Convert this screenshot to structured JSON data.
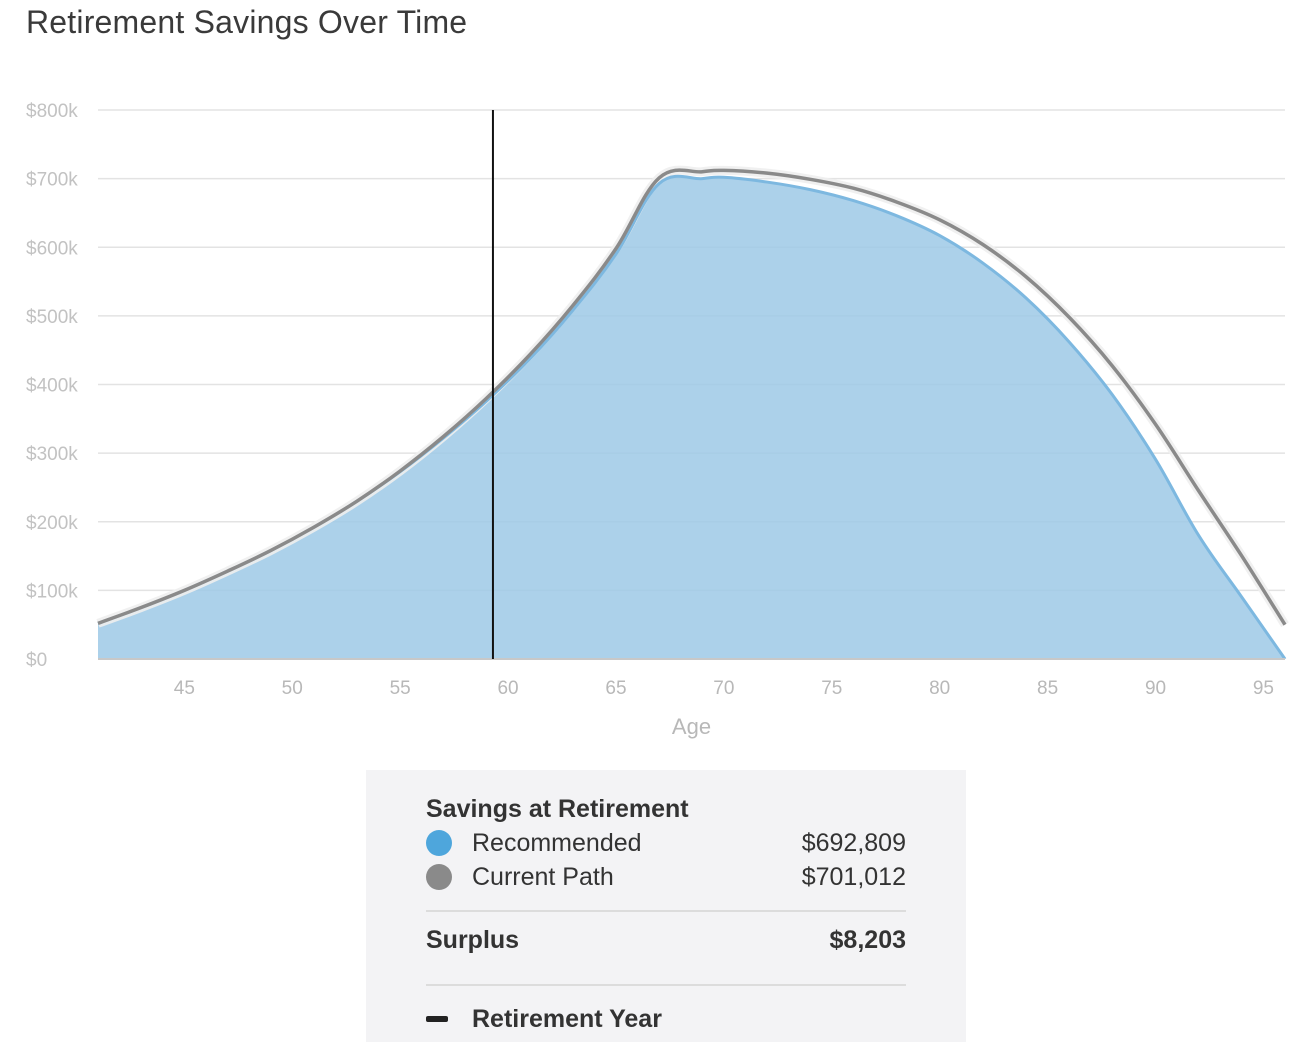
{
  "chart_data": {
    "type": "area",
    "title": "Retirement Savings Over Time",
    "xlabel": "Age",
    "ylabel": "",
    "xlim": [
      41,
      96
    ],
    "ylim": [
      0,
      800000
    ],
    "x_ticks": [
      45,
      50,
      55,
      60,
      65,
      70,
      75,
      80,
      85,
      90,
      95
    ],
    "x_tick_labels": [
      "45",
      "50",
      "55",
      "60",
      "65",
      "70",
      "75",
      "80",
      "85",
      "90",
      "95"
    ],
    "y_ticks": [
      0,
      100000,
      200000,
      300000,
      400000,
      500000,
      600000,
      700000,
      800000
    ],
    "y_tick_labels": [
      "$0",
      "$100k",
      "$200k",
      "$300k",
      "$400k",
      "$500k",
      "$600k",
      "$700k",
      "$800k"
    ],
    "grid": true,
    "retirement_marker_age": 59.3,
    "series": [
      {
        "name": "Recommended",
        "color": "#9ec9e6",
        "line_color": "#7db8e0",
        "style": "area",
        "x": [
          41,
          43,
          45,
          47,
          49,
          51,
          53,
          55,
          57,
          59,
          61,
          63,
          65,
          67,
          69,
          70,
          72,
          74,
          76,
          78,
          80,
          82,
          84,
          86,
          88,
          90,
          92,
          94,
          96
        ],
        "values": [
          52000,
          75000,
          100000,
          128000,
          158000,
          192000,
          230000,
          273000,
          322000,
          376000,
          437000,
          508000,
          590000,
          692809,
          700000,
          702000,
          695000,
          684000,
          668000,
          646000,
          617000,
          577000,
          526000,
          462000,
          385000,
          291000,
          180000,
          90000,
          0
        ]
      },
      {
        "name": "Current Path",
        "color": "#8a8a8a",
        "style": "line",
        "x": [
          41,
          43,
          45,
          47,
          49,
          51,
          53,
          55,
          57,
          59,
          61,
          63,
          65,
          67,
          69,
          70,
          72,
          74,
          76,
          78,
          80,
          82,
          84,
          86,
          88,
          90,
          92,
          94,
          96
        ],
        "values": [
          52000,
          75000,
          100000,
          128000,
          158000,
          192000,
          230000,
          274000,
          324000,
          380000,
          443000,
          515000,
          598000,
          701012,
          710000,
          712000,
          708000,
          699000,
          686000,
          666000,
          640000,
          604000,
          557000,
          498000,
          427000,
          342000,
          245000,
          150000,
          50000
        ]
      }
    ]
  },
  "legend": {
    "heading": "Savings at Retirement",
    "items": [
      {
        "label": "Recommended",
        "value": "$692,809",
        "color": "#4ea6dc"
      },
      {
        "label": "Current Path",
        "value": "$701,012",
        "color": "#8a8a8a"
      }
    ],
    "surplus_label": "Surplus",
    "surplus_value": "$8,203",
    "retirement_label": "Retirement Year"
  }
}
